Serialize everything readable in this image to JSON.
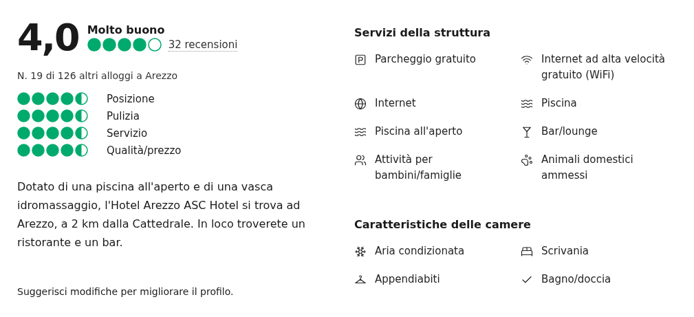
{
  "rating": {
    "score": "4,0",
    "label": "Molto buono",
    "stars": 4,
    "reviews": "32 recensioni"
  },
  "rank": "N. 19 di 126 altri alloggi a Arezzo",
  "subratings": [
    {
      "label": "Posizione",
      "stars": 4.5
    },
    {
      "label": "Pulizia",
      "stars": 4.5
    },
    {
      "label": "Servizio",
      "stars": 4.5
    },
    {
      "label": "Qualità/prezzo",
      "stars": 4.5
    }
  ],
  "description": "Dotato di una piscina all'aperto e di una vasca idromassaggio, l'Hotel Arezzo ASC Hotel si trova ad Arezzo, a 2 km dalla Cattedrale. In loco troverete un ristorante e un bar.",
  "suggest_link": "Suggerisci modifiche per migliorare il profilo.",
  "sections": [
    {
      "title": "Servizi della struttura",
      "items": [
        "Parcheggio gratuito",
        "Internet ad alta velocità gratuito (WiFi)",
        "Internet",
        "Piscina",
        "Piscina all'aperto",
        "Bar/lounge",
        "Attività per bambini/famiglie",
        "Animali domestici ammessi"
      ]
    },
    {
      "title": "Caratteristiche delle camere",
      "items": [
        "Aria condizionata",
        "Scrivania",
        "Appendiabiti",
        "Bagno/doccia"
      ]
    }
  ]
}
